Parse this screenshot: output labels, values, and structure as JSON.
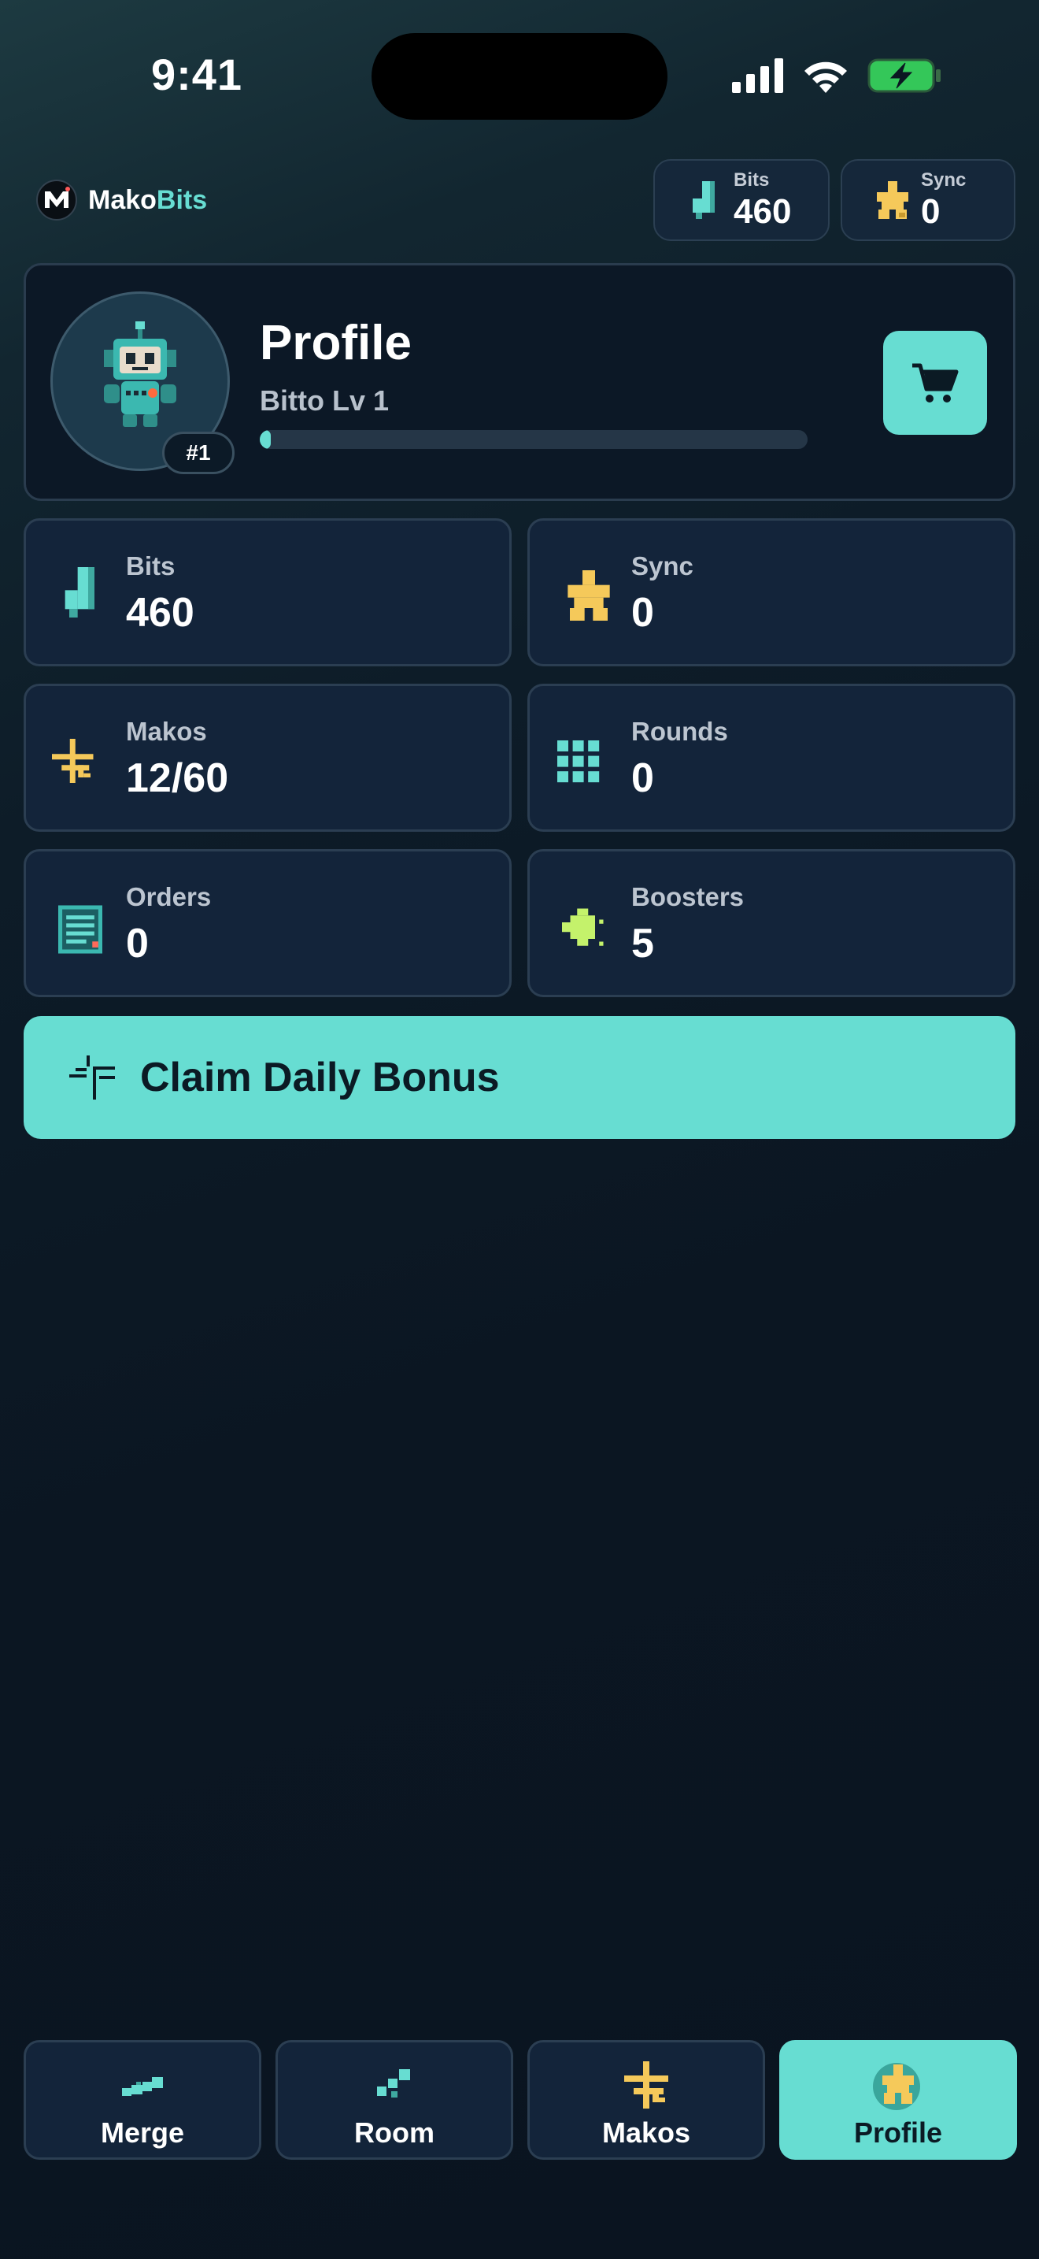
{
  "status_bar": {
    "time": "9:41"
  },
  "brand": {
    "name_part1": "Mako",
    "name_part2": "Bits"
  },
  "header": {
    "bits": {
      "label": "Bits",
      "value": "460"
    },
    "sync": {
      "label": "Sync",
      "value": "0"
    }
  },
  "profile": {
    "title": "Profile",
    "subtitle": "Bitto Lv 1",
    "rank": "#1",
    "xp_progress": 0.02
  },
  "stats": [
    {
      "label": "Bits",
      "value": "460",
      "icon": "bits-icon"
    },
    {
      "label": "Sync",
      "value": "0",
      "icon": "sync-icon"
    },
    {
      "label": "Makos",
      "value": "12/60",
      "icon": "makos-icon"
    },
    {
      "label": "Rounds",
      "value": "0",
      "icon": "rounds-icon"
    },
    {
      "label": "Orders",
      "value": "0",
      "icon": "orders-icon"
    },
    {
      "label": "Boosters",
      "value": "5",
      "icon": "boosters-icon"
    }
  ],
  "claim_button": {
    "label": "Claim Daily Bonus"
  },
  "tabs": [
    {
      "label": "Merge",
      "icon": "merge-icon"
    },
    {
      "label": "Room",
      "icon": "room-icon"
    },
    {
      "label": "Makos",
      "icon": "makos-icon"
    },
    {
      "label": "Profile",
      "icon": "profile-icon",
      "active": true
    }
  ],
  "colors": {
    "accent": "#67ddd2",
    "gold": "#f5c95a",
    "lime": "#c4f26b",
    "tile_bg": "#13243a",
    "card_bg": "#0c1826"
  }
}
